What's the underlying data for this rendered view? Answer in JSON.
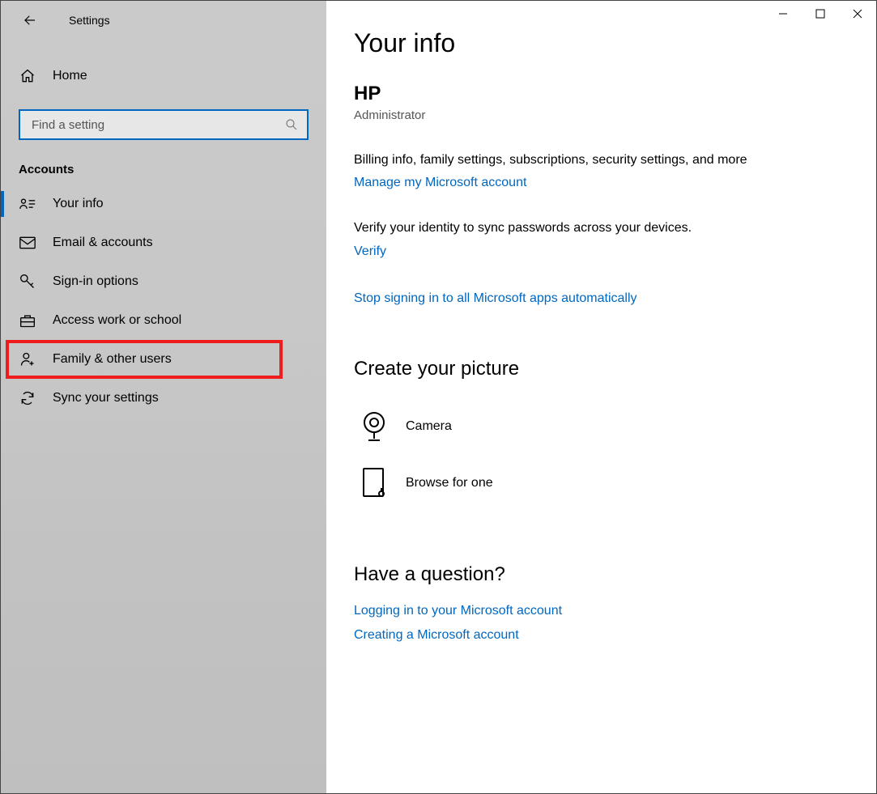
{
  "app": {
    "title": "Settings"
  },
  "home": {
    "label": "Home"
  },
  "search": {
    "placeholder": "Find a setting"
  },
  "section": {
    "label": "Accounts"
  },
  "nav": {
    "your_info": "Your info",
    "email_accounts": "Email & accounts",
    "signin_options": "Sign-in options",
    "access_work": "Access work or school",
    "family_other": "Family & other users",
    "sync_settings": "Sync your settings"
  },
  "page": {
    "title": "Your info",
    "user_name": "HP",
    "user_role": "Administrator",
    "billing_text": "Billing info, family settings, subscriptions, security settings, and more",
    "manage_link": "Manage my Microsoft account",
    "verify_text": "Verify your identity to sync passwords across your devices.",
    "verify_link": "Verify",
    "stop_signin_link": "Stop signing in to all Microsoft apps automatically",
    "create_picture_title": "Create your picture",
    "camera_label": "Camera",
    "browse_label": "Browse for one",
    "question_title": "Have a question?",
    "help_login": "Logging in to your Microsoft account",
    "help_create": "Creating a Microsoft account"
  }
}
